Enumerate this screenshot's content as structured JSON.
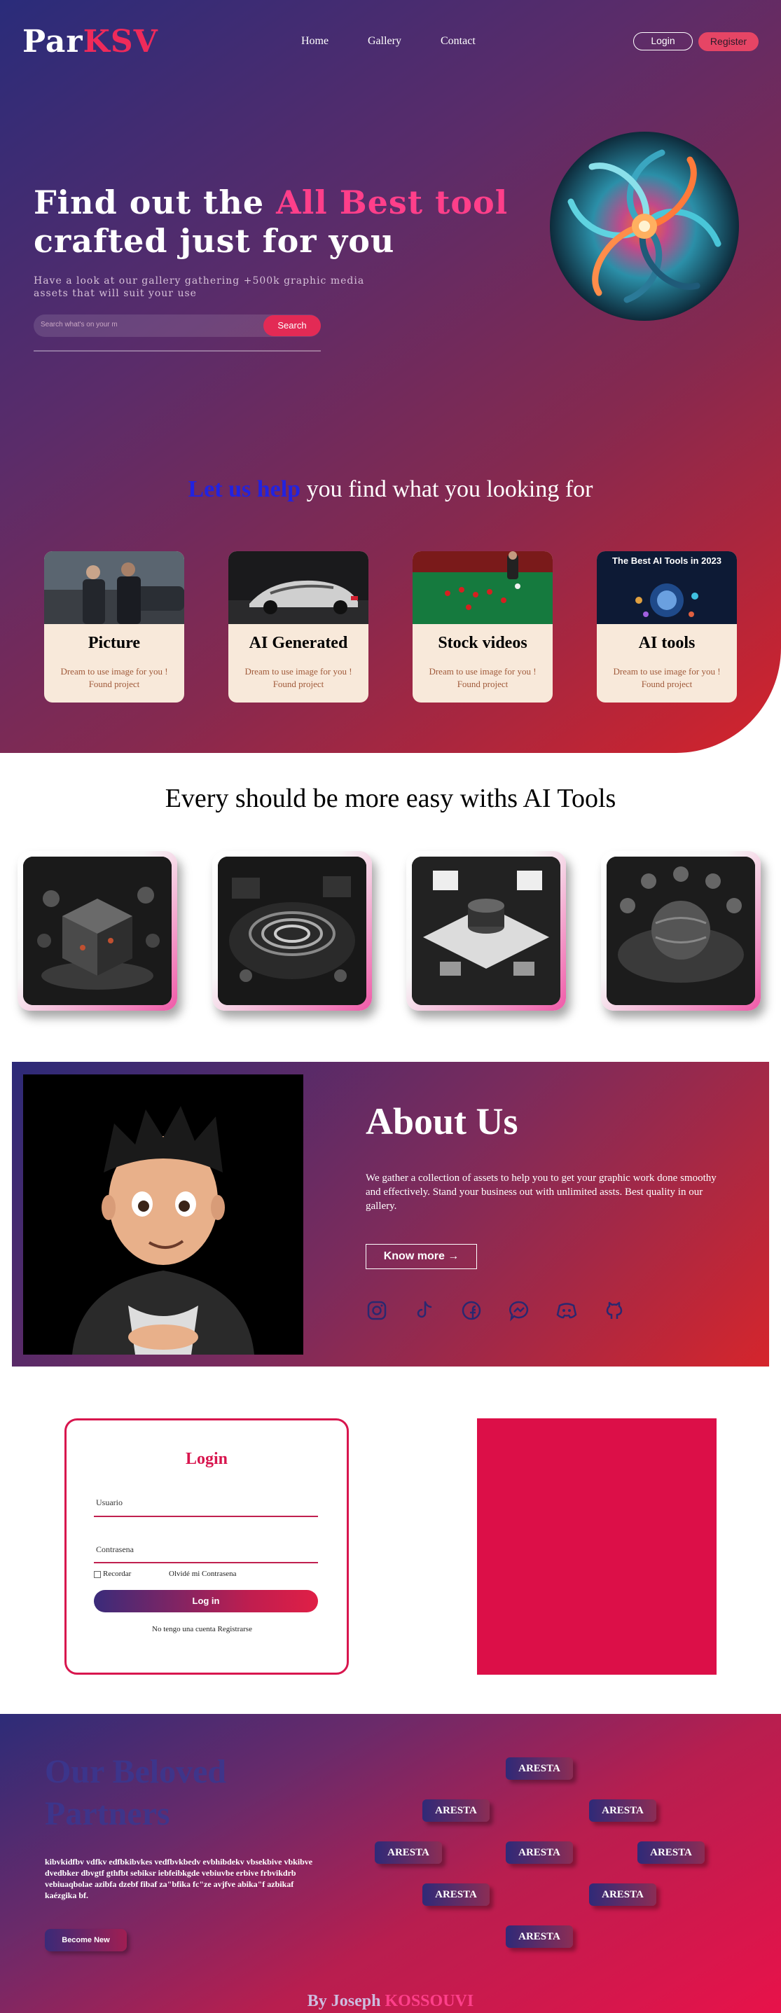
{
  "brand": {
    "part1": "Par",
    "part2": "KSV"
  },
  "nav": {
    "home": "Home",
    "gallery": "Gallery",
    "contact": "Contact"
  },
  "auth": {
    "login": "Login",
    "register": "Register"
  },
  "hero": {
    "line1_a": "Find out the ",
    "line1_b": "All Best tool",
    "line2": "crafted just for you",
    "subtitle": "Have a look at our gallery gathering +500k graphic media assets that will suit your use",
    "search_placeholder": "Search what's on your m",
    "search_button": "Search"
  },
  "help": {
    "highlight": "Let us help",
    "rest": " you find what you looking for"
  },
  "categories": [
    {
      "title": "Picture",
      "desc": "Dream to use image for you ! Found project"
    },
    {
      "title": "AI Generated",
      "desc": "Dream to use image for you ! Found project"
    },
    {
      "title": "Stock videos",
      "desc": "Dream to use image for you ! Found project"
    },
    {
      "title": "AI tools",
      "desc": "Dream to use image for you ! Found project",
      "image_caption": "The Best AI Tools in 2023"
    }
  ],
  "tools": {
    "title": "Every should be more easy withs AI Tools"
  },
  "about": {
    "title": "About Us",
    "text": "We gather a collection of assets to help you to get your graphic work done smoothy and effectively. Stand your business out with unlimited assts. Best quality in our gallery.",
    "button": "Know more →",
    "social_icons": [
      "instagram-icon",
      "tiktok-icon",
      "facebook-icon",
      "messenger-icon",
      "discord-icon",
      "github-icon"
    ]
  },
  "login": {
    "title": "Login",
    "user_label": "Usuario",
    "pass_label": "Contrasena",
    "remember": "Recordar",
    "forgot": "Olvidé mi Contrasena",
    "submit": "Log in",
    "no_account": "No tengo una cuenta ",
    "register": "Registrarse"
  },
  "partners": {
    "title_line1": "Our Beloved",
    "title_line2": "Partners",
    "text": "kibvkidfbv vdfkv edfbkibvkes vedfbvkbedv evbhibdekv vbsekbive vbkibve dvedbker dbvgtf gthfbt sebiksr iebfeibkgde vebiuvbe erbive frbvikdrb vebiuaqbolae azibfa dzebf fibaf za\"bfika fc\"ze avjfve abika\"f azbikaf kaézgika bf.",
    "button": "Become New",
    "logo_label": "ARESTA"
  },
  "footer": {
    "by": "By Joseph ",
    "name": "KOSSOUVI"
  },
  "colors": {
    "accent": "#ef2a5a",
    "login_accent": "#d8164e",
    "red_box": "#dc0f48"
  }
}
